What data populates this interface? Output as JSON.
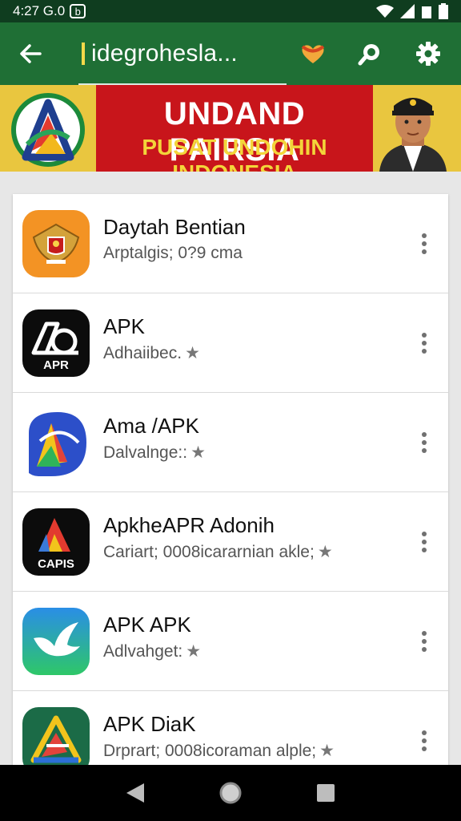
{
  "status_bar": {
    "time": "4:27 G.0",
    "indicator": "b",
    "icons": [
      "wifi-icon",
      "signal-icon",
      "sim-icon",
      "battery-icon"
    ]
  },
  "app_bar": {
    "title": "idegrohesla...",
    "icons": [
      "back-arrow-icon",
      "heart-icon",
      "search-icon",
      "gear-icon"
    ],
    "color": "#1f6f35"
  },
  "banner": {
    "line1": "UNDAND PAIRSIA",
    "line2": "PUSAT UNDOHIN INDONESIA",
    "color": "#c8151b",
    "accent": "#f3d53a"
  },
  "apps": [
    {
      "name": "Daytah Bentian",
      "subtitle": "Arptalgis; 0?9 cma",
      "has_star": false,
      "icon": "garuda-emblem-icon"
    },
    {
      "name": "APK",
      "subtitle": "Adhaiibec.",
      "has_star": true,
      "icon_label": "APR",
      "icon": "apk-shield-icon"
    },
    {
      "name": "Ama /APK",
      "subtitle": "Dalvalnge::",
      "has_star": true,
      "icon": "colorful-a-icon"
    },
    {
      "name": "ApkheAPR Adonih",
      "subtitle": "Cariart; 0008icararnian akle;",
      "has_star": true,
      "icon_label": "CAPIS",
      "icon": "capis-a-icon"
    },
    {
      "name": "APK APK",
      "subtitle": "Adlvahget:",
      "has_star": true,
      "icon": "bird-icon"
    },
    {
      "name": "APK DiaK",
      "subtitle": "Drprart; 0008icoraman alple;",
      "has_star": true,
      "icon": "triangle-logo-icon"
    }
  ],
  "nav": {
    "icons": [
      "nav-back-icon",
      "nav-home-icon",
      "nav-recents-icon"
    ]
  }
}
